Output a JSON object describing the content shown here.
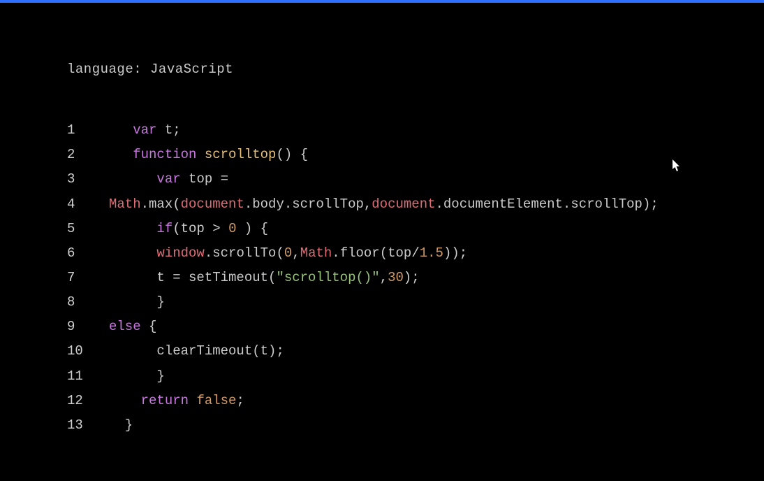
{
  "language_label": "language: JavaScript",
  "code": {
    "lines": [
      {
        "num": "1",
        "tokens": [
          {
            "t": "   ",
            "c": "tok-plain"
          },
          {
            "t": "var",
            "c": "tok-kw"
          },
          {
            "t": " t;",
            "c": "tok-plain"
          }
        ]
      },
      {
        "num": "2",
        "tokens": [
          {
            "t": "   ",
            "c": "tok-plain"
          },
          {
            "t": "function",
            "c": "tok-kw"
          },
          {
            "t": " ",
            "c": "tok-plain"
          },
          {
            "t": "scrolltop",
            "c": "tok-name"
          },
          {
            "t": "() {",
            "c": "tok-plain"
          }
        ]
      },
      {
        "num": "3",
        "tokens": [
          {
            "t": "      ",
            "c": "tok-plain"
          },
          {
            "t": "var",
            "c": "tok-kw"
          },
          {
            "t": " top =",
            "c": "tok-plain"
          }
        ]
      },
      {
        "num": "4",
        "tokens": [
          {
            "t": "Math",
            "c": "tok-obj"
          },
          {
            "t": ".max(",
            "c": "tok-plain"
          },
          {
            "t": "document",
            "c": "tok-obj"
          },
          {
            "t": ".body.scrollTop,",
            "c": "tok-plain"
          },
          {
            "t": "document",
            "c": "tok-obj"
          },
          {
            "t": ".documentElement.scrollTop);",
            "c": "tok-plain"
          }
        ]
      },
      {
        "num": "5",
        "tokens": [
          {
            "t": "      ",
            "c": "tok-plain"
          },
          {
            "t": "if",
            "c": "tok-kw"
          },
          {
            "t": "(top > ",
            "c": "tok-plain"
          },
          {
            "t": "0",
            "c": "tok-num"
          },
          {
            "t": " ) {",
            "c": "tok-plain"
          }
        ]
      },
      {
        "num": "6",
        "tokens": [
          {
            "t": "      ",
            "c": "tok-plain"
          },
          {
            "t": "window",
            "c": "tok-obj"
          },
          {
            "t": ".scrollTo(",
            "c": "tok-plain"
          },
          {
            "t": "0",
            "c": "tok-num"
          },
          {
            "t": ",",
            "c": "tok-plain"
          },
          {
            "t": "Math",
            "c": "tok-obj"
          },
          {
            "t": ".floor(top/",
            "c": "tok-plain"
          },
          {
            "t": "1.5",
            "c": "tok-num"
          },
          {
            "t": "));",
            "c": "tok-plain"
          }
        ]
      },
      {
        "num": "7",
        "tokens": [
          {
            "t": "      t = setTimeout(",
            "c": "tok-plain"
          },
          {
            "t": "\"scrolltop()\"",
            "c": "tok-str"
          },
          {
            "t": ",",
            "c": "tok-plain"
          },
          {
            "t": "30",
            "c": "tok-num"
          },
          {
            "t": ");",
            "c": "tok-plain"
          }
        ]
      },
      {
        "num": "8",
        "tokens": [
          {
            "t": "      }",
            "c": "tok-plain"
          }
        ]
      },
      {
        "num": "9",
        "tokens": [
          {
            "t": "else",
            "c": "tok-kw"
          },
          {
            "t": " {",
            "c": "tok-plain"
          }
        ]
      },
      {
        "num": "10",
        "tokens": [
          {
            "t": "      clearTimeout(t);",
            "c": "tok-plain"
          }
        ]
      },
      {
        "num": "11",
        "tokens": [
          {
            "t": "      }",
            "c": "tok-plain"
          }
        ]
      },
      {
        "num": "12",
        "tokens": [
          {
            "t": "    ",
            "c": "tok-plain"
          },
          {
            "t": "return",
            "c": "tok-kw"
          },
          {
            "t": " ",
            "c": "tok-plain"
          },
          {
            "t": "false",
            "c": "tok-num"
          },
          {
            "t": ";",
            "c": "tok-plain"
          }
        ]
      },
      {
        "num": "13",
        "tokens": [
          {
            "t": "  }",
            "c": "tok-plain"
          }
        ]
      }
    ]
  }
}
